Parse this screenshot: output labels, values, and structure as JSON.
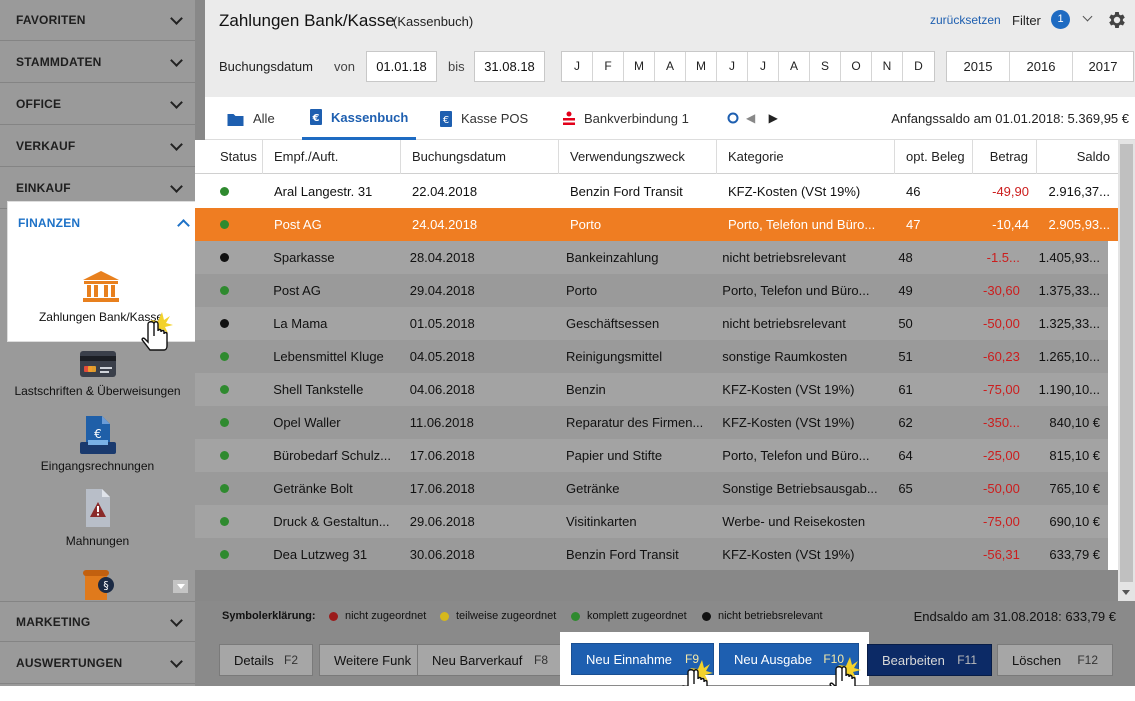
{
  "sidebar": {
    "sections": [
      {
        "label": "FAVORITEN"
      },
      {
        "label": "STAMMDATEN"
      },
      {
        "label": "OFFICE"
      },
      {
        "label": "VERKAUF"
      },
      {
        "label": "EINKAUF"
      },
      {
        "label": "FINANZEN"
      },
      {
        "label": "MARKETING"
      },
      {
        "label": "AUSWERTUNGEN"
      }
    ],
    "items": [
      {
        "label": "Zahlungen Bank/Kasse",
        "icon": "bank-building-icon"
      },
      {
        "label": "Lastschriften & Überweisungen",
        "icon": "credit-card-icon"
      },
      {
        "label": "Eingangsrechnungen",
        "icon": "euro-document-icon"
      },
      {
        "label": "Mahnungen",
        "icon": "warning-document-icon"
      },
      {
        "label": "",
        "icon": "paragraph-scroll-icon"
      }
    ]
  },
  "header": {
    "title": "Zahlungen Bank/Kasse",
    "subtitle": "(Kassenbuch)",
    "reset_label": "zurücksetzen",
    "filter_label": "Filter",
    "filter_count": "1",
    "date_label": "Buchungsdatum",
    "from_label": "von",
    "from_value": "01.01.18",
    "to_label": "bis",
    "to_value": "31.08.18",
    "months": [
      "J",
      "F",
      "M",
      "A",
      "M",
      "J",
      "J",
      "A",
      "S",
      "O",
      "N",
      "D"
    ],
    "years": [
      "2015",
      "2016",
      "2017"
    ]
  },
  "tabs": {
    "items": [
      {
        "label": "Alle",
        "icon": "folder-icon"
      },
      {
        "label": "Kassenbuch",
        "icon": "cashbook-icon"
      },
      {
        "label": "Kasse POS",
        "icon": "cashbook-icon"
      },
      {
        "label": "Bankverbindung 1",
        "icon": "sparkasse-icon"
      }
    ],
    "opening_balance": "Anfangssaldo am 01.01.2018: 5.369,95 €"
  },
  "table": {
    "columns": [
      "Status",
      "Empf./Auft.",
      "Buchungsdatum",
      "Verwendungszweck",
      "Kategorie",
      "opt. Beleg",
      "Betrag",
      "Saldo"
    ],
    "rows": [
      {
        "status": "green",
        "payee": "Aral Langestr. 31",
        "date": "22.04.2018",
        "purpose": "Benzin Ford Transit",
        "category": "KFZ-Kosten (VSt 19%)",
        "receipt": "46",
        "amount": "-49,90",
        "balance": "2.916,37..."
      },
      {
        "status": "green",
        "payee": "Post AG",
        "date": "24.04.2018",
        "purpose": "Porto",
        "category": "Porto, Telefon und Büro...",
        "receipt": "47",
        "amount": "-10,44",
        "balance": "2.905,93..."
      },
      {
        "status": "black",
        "payee": "Sparkasse",
        "date": "28.04.2018",
        "purpose": "Bankeinzahlung",
        "category": "nicht betriebsrelevant",
        "receipt": "48",
        "amount": "-1.5...",
        "balance": "1.405,93..."
      },
      {
        "status": "green",
        "payee": "Post AG",
        "date": "29.04.2018",
        "purpose": "Porto",
        "category": "Porto, Telefon und Büro...",
        "receipt": "49",
        "amount": "-30,60",
        "balance": "1.375,33..."
      },
      {
        "status": "black",
        "payee": "La Mama",
        "date": "01.05.2018",
        "purpose": "Geschäftsessen",
        "category": "nicht betriebsrelevant",
        "receipt": "50",
        "amount": "-50,00",
        "balance": "1.325,33..."
      },
      {
        "status": "green",
        "payee": "Lebensmittel Kluge",
        "date": "04.05.2018",
        "purpose": "Reinigungsmittel",
        "category": "sonstige Raumkosten",
        "receipt": "51",
        "amount": "-60,23",
        "balance": "1.265,10..."
      },
      {
        "status": "green",
        "payee": "Shell Tankstelle",
        "date": "04.06.2018",
        "purpose": "Benzin",
        "category": "KFZ-Kosten (VSt 19%)",
        "receipt": "61",
        "amount": "-75,00",
        "balance": "1.190,10..."
      },
      {
        "status": "green",
        "payee": "Opel Waller",
        "date": "11.06.2018",
        "purpose": "Reparatur des Firmen...",
        "category": "KFZ-Kosten (VSt 19%)",
        "receipt": "62",
        "amount": "-350...",
        "balance": "840,10 €"
      },
      {
        "status": "green",
        "payee": "Bürobedarf Schulz...",
        "date": "17.06.2018",
        "purpose": "Papier und Stifte",
        "category": "Porto, Telefon und Büro...",
        "receipt": "64",
        "amount": "-25,00",
        "balance": "815,10 €"
      },
      {
        "status": "green",
        "payee": "Getränke Bolt",
        "date": "17.06.2018",
        "purpose": "Getränke",
        "category": "Sonstige Betriebsausgab...",
        "receipt": "65",
        "amount": "-50,00",
        "balance": "765,10 €"
      },
      {
        "status": "green",
        "payee": "Druck & Gestaltun...",
        "date": "29.06.2018",
        "purpose": "Visitinkarten",
        "category": "Werbe- und Reisekosten",
        "receipt": "",
        "amount": "-75,00",
        "balance": "690,10 €"
      },
      {
        "status": "green",
        "payee": "Dea Lutzweg 31",
        "date": "30.06.2018",
        "purpose": "Benzin Ford Transit",
        "category": "KFZ-Kosten (VSt 19%)",
        "receipt": "",
        "amount": "-56,31",
        "balance": "633,79 €"
      }
    ]
  },
  "legend": {
    "title": "Symbolerklärung:",
    "items": [
      {
        "label": "nicht zugeordnet",
        "color": "#9b1b1b"
      },
      {
        "label": "teilweise zugeordnet",
        "color": "#d6b81c"
      },
      {
        "label": "komplett zugeordnet",
        "color": "#2f8a2f"
      },
      {
        "label": "nicht betriebsrelevant",
        "color": "#111111"
      }
    ],
    "closing_balance": "Endsaldo am 31.08.2018: 633,79 €"
  },
  "footer": {
    "buttons": [
      {
        "label": "Details",
        "key": "F2"
      },
      {
        "label": "Weitere Funk",
        "key": ""
      },
      {
        "label": "Neu Barverkauf",
        "key": "F8"
      },
      {
        "label": "Neu Einnahme",
        "key": "F9"
      },
      {
        "label": "Neu Ausgabe",
        "key": "F10"
      },
      {
        "label": "Bearbeiten",
        "key": "F11"
      },
      {
        "label": "Löschen",
        "key": "F12"
      }
    ]
  },
  "colors": {
    "accent_blue": "#1e5fb0",
    "selected_row": "#ef7d22",
    "negative_amount": "#cc1d1d",
    "status_green": "#2f8a2f",
    "status_black": "#111111"
  }
}
